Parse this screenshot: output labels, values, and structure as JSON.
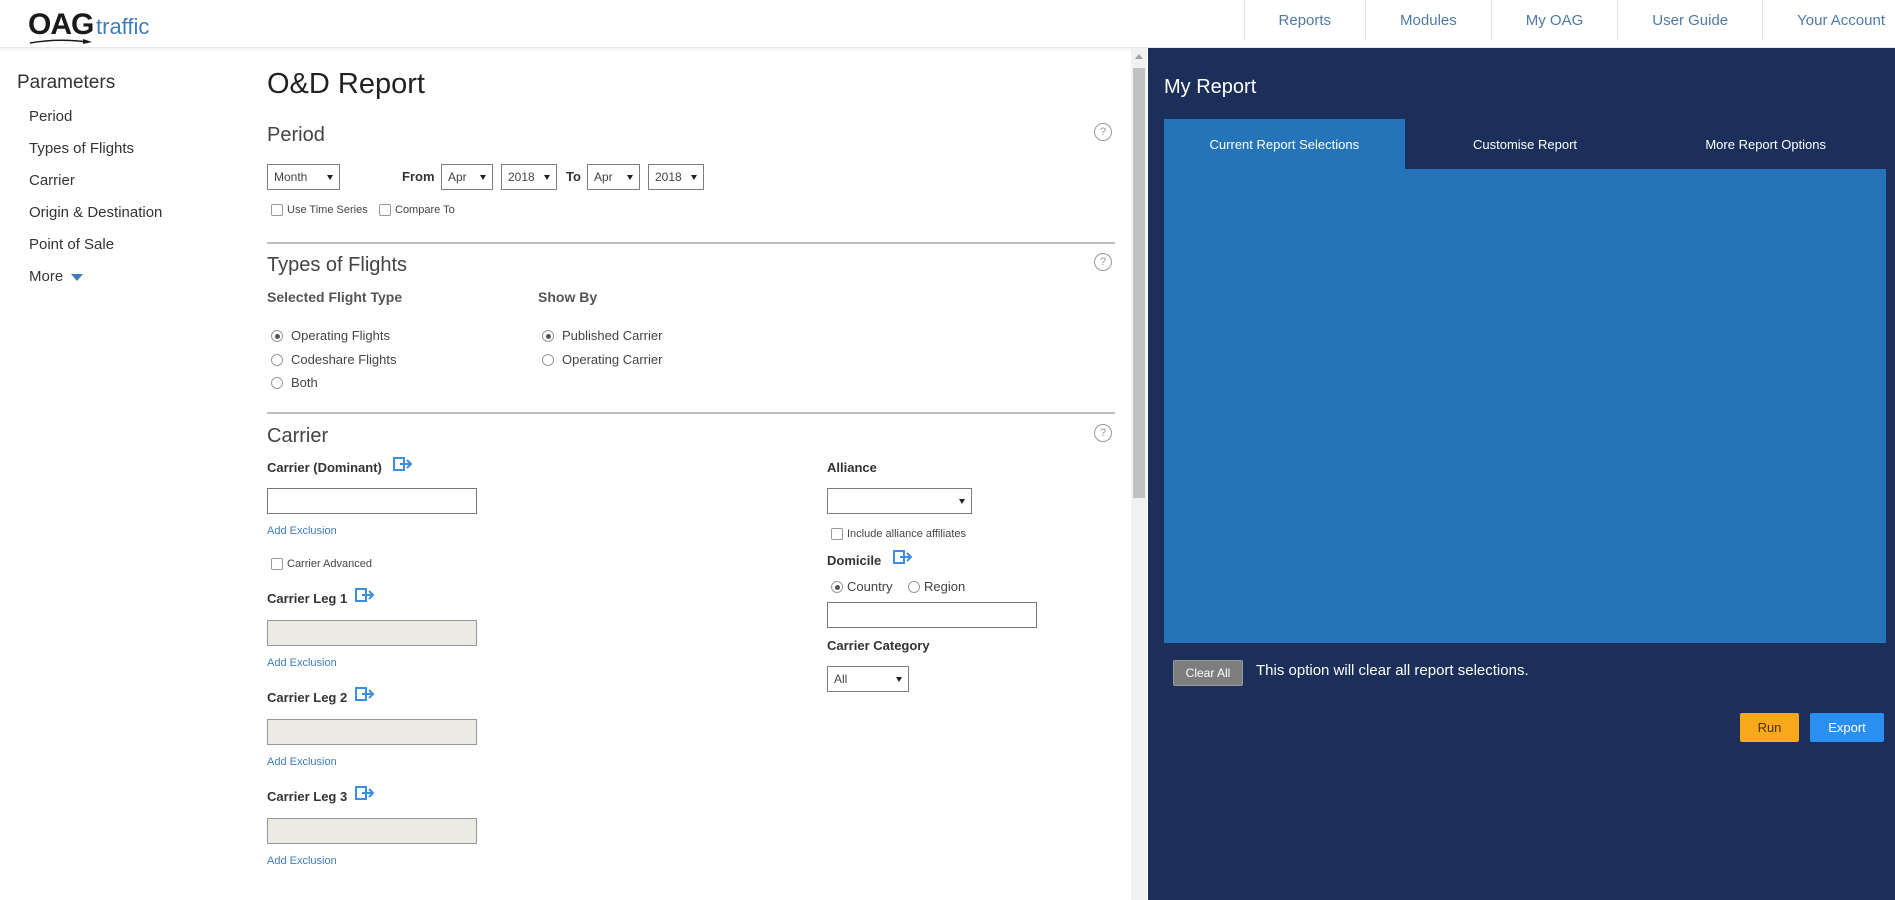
{
  "header": {
    "logo_main": "OAG",
    "logo_sub": "traffic",
    "nav": [
      {
        "label": "Reports"
      },
      {
        "label": "Modules"
      },
      {
        "label": "My OAG"
      },
      {
        "label": "User Guide"
      },
      {
        "label": "Your Account"
      }
    ]
  },
  "sidebar": {
    "title": "Parameters",
    "items": [
      {
        "label": "Period"
      },
      {
        "label": "Types of Flights"
      },
      {
        "label": "Carrier"
      },
      {
        "label": "Origin & Destination"
      },
      {
        "label": "Point of Sale"
      },
      {
        "label": "More"
      }
    ]
  },
  "main": {
    "title": "O&D Report",
    "help_glyph": "?",
    "period": {
      "title": "Period",
      "granularity": "Month",
      "from_label": "From",
      "from_month": "Apr",
      "from_year": "2018",
      "to_label": "To",
      "to_month": "Apr",
      "to_year": "2018",
      "use_time_series": "Use Time Series",
      "compare_to": "Compare To"
    },
    "flights": {
      "title": "Types of Flights",
      "flight_type_heading": "Selected Flight Type",
      "flight_types": [
        "Operating Flights",
        "Codeshare Flights",
        "Both"
      ],
      "show_by_heading": "Show By",
      "show_by": [
        "Published Carrier",
        "Operating Carrier"
      ]
    },
    "carrier": {
      "title": "Carrier",
      "dominant_label": "Carrier (Dominant)",
      "add_exclusion": "Add Exclusion",
      "carrier_advanced": "Carrier Advanced",
      "leg1": "Carrier Leg 1",
      "leg2": "Carrier Leg 2",
      "leg3": "Carrier Leg 3",
      "alliance_label": "Alliance",
      "alliance_value": "",
      "include_affiliates": "Include alliance affiliates",
      "domicile_label": "Domicile",
      "domicile_country": "Country",
      "domicile_region": "Region",
      "category_label": "Carrier Category",
      "category_value": "All"
    }
  },
  "report_panel": {
    "title": "My Report",
    "tabs": [
      "Current Report Selections",
      "Customise Report",
      "More Report Options"
    ],
    "clear_all": "Clear All",
    "clear_note": "This option will clear all report selections.",
    "run": "Run",
    "export": "Export"
  },
  "colors": {
    "panel_bg": "#1b2f5a",
    "tab_active": "#2574b9",
    "run_button": "#f7a81b",
    "export_button": "#2a8ff0",
    "link": "#3d7dbd"
  }
}
